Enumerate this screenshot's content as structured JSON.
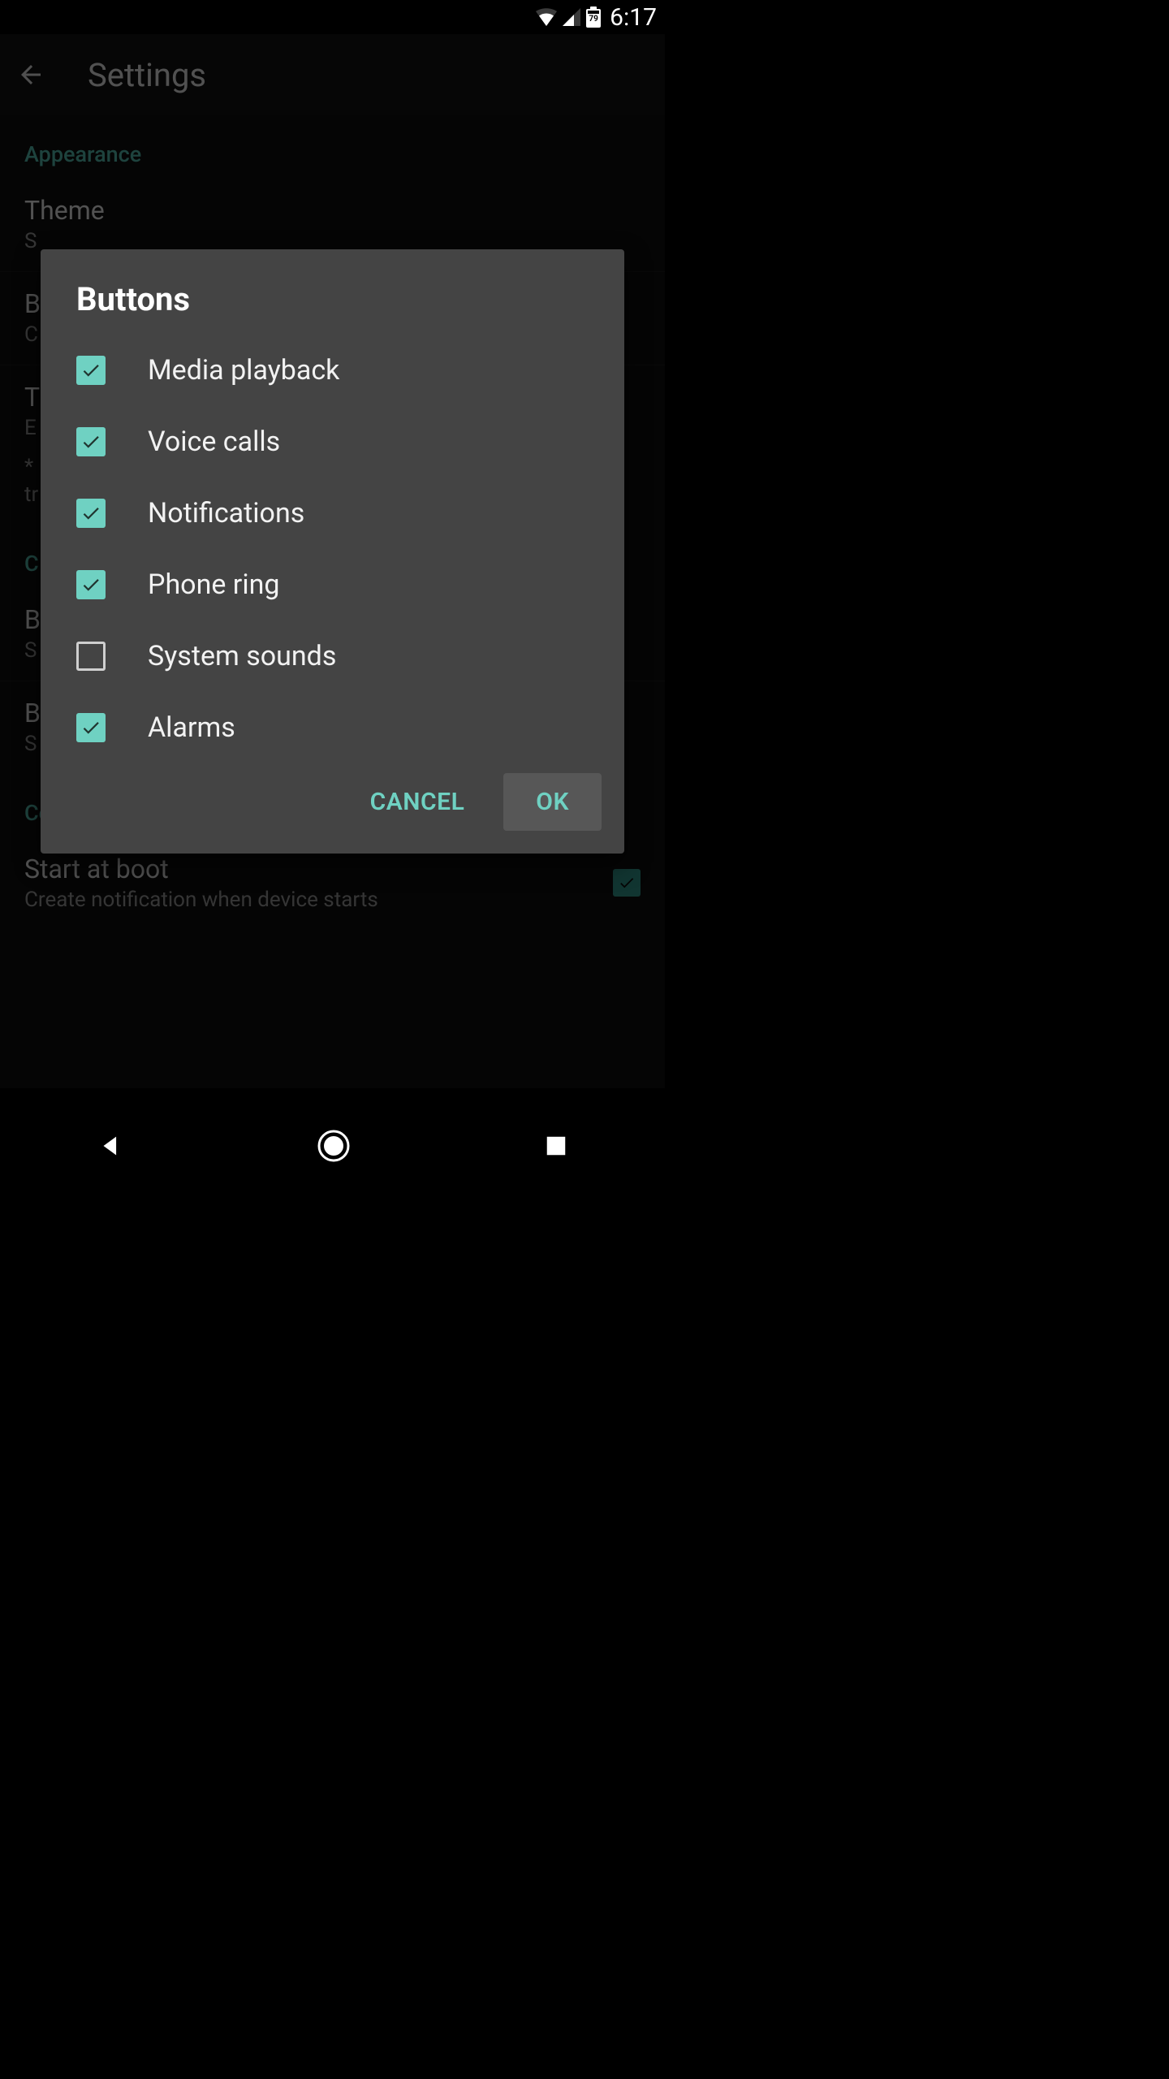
{
  "status": {
    "battery_text": "79",
    "clock": "6:17"
  },
  "appbar": {
    "title": "Settings"
  },
  "sections": {
    "appearance": {
      "label": "Appearance",
      "theme": {
        "title": "Theme",
        "sub": "S"
      },
      "buttons": {
        "title": "B",
        "sub": "C"
      },
      "track": {
        "title": "T",
        "sub": "E",
        "note1": "*",
        "note2": "tr"
      }
    },
    "c_section": {
      "label": "C",
      "b1": {
        "title": "B",
        "sub": "S"
      },
      "b2": {
        "title": "B",
        "sub": "S"
      }
    },
    "configuration": {
      "label": "Configuration",
      "start": {
        "title": "Start at boot",
        "sub": "Create notification when device starts",
        "checked": true
      }
    }
  },
  "dialog": {
    "title": "Buttons",
    "options": [
      {
        "label": "Media playback",
        "checked": true
      },
      {
        "label": "Voice calls",
        "checked": true
      },
      {
        "label": "Notifications",
        "checked": true
      },
      {
        "label": "Phone ring",
        "checked": true
      },
      {
        "label": "System sounds",
        "checked": false
      },
      {
        "label": "Alarms",
        "checked": true
      }
    ],
    "cancel": "CANCEL",
    "ok": "OK"
  },
  "colors": {
    "accent": "#6fd1c2",
    "accent_dim": "#4fb1a3",
    "dialog_bg": "#444444"
  }
}
